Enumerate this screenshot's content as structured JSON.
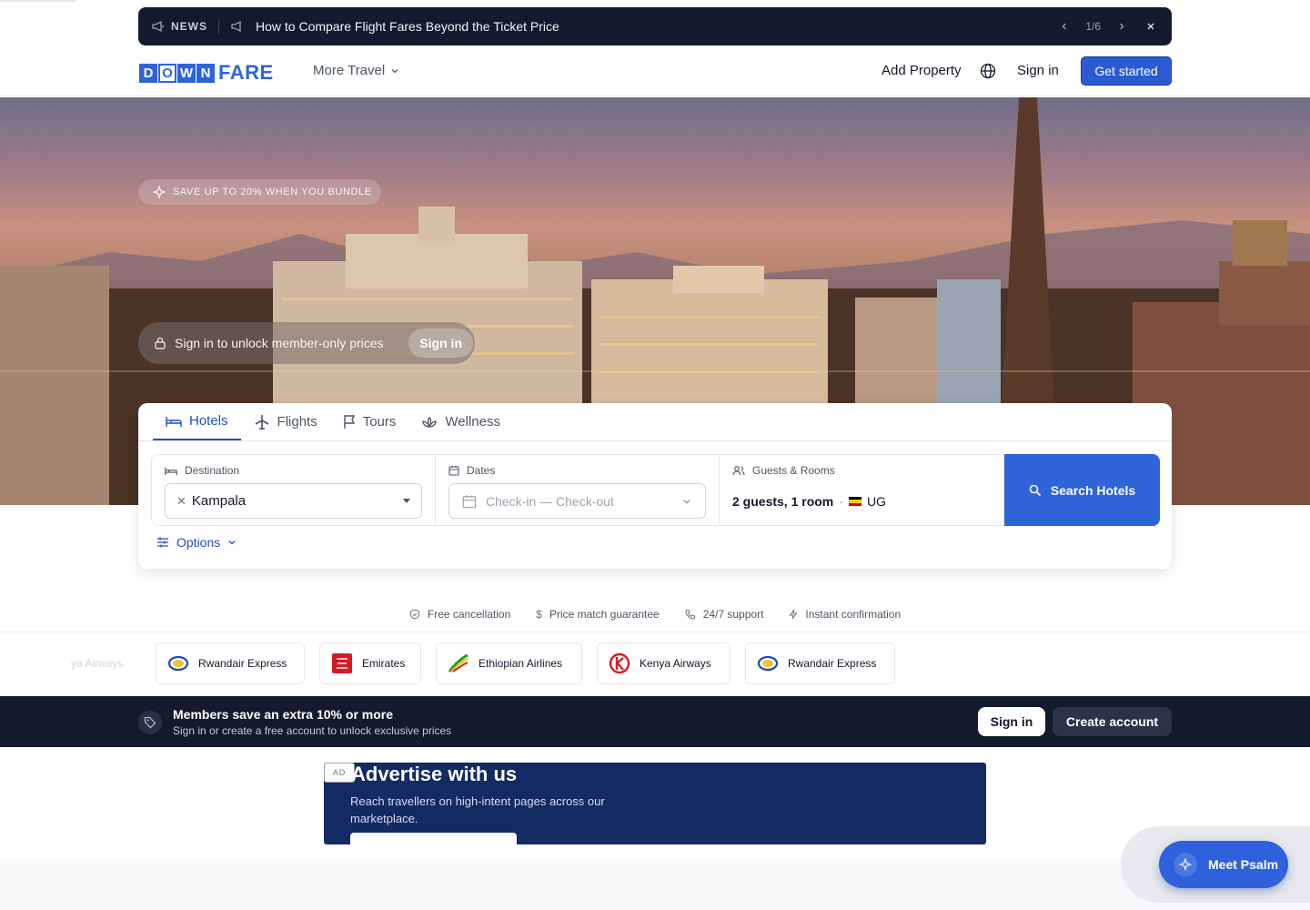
{
  "news": {
    "label": "NEWS",
    "title": "How to Compare Flight Fares Beyond the Ticket Price",
    "pager": "1/6"
  },
  "header": {
    "logo_letters": [
      "D",
      "O",
      "W",
      "N"
    ],
    "logo_suffix": "FARE",
    "more_travel": "More Travel",
    "add_property": "Add Property",
    "sign_in": "Sign in",
    "get_started": "Get started"
  },
  "hero": {
    "promo_badge": "SAVE UP TO 20% WHEN YOU BUNDLE",
    "member_text": "Sign in to unlock member-only prices",
    "member_button": "Sign in"
  },
  "search": {
    "tabs": [
      {
        "label": "Hotels",
        "icon": "bed-icon",
        "active": true
      },
      {
        "label": "Flights",
        "icon": "plane-icon",
        "active": false
      },
      {
        "label": "Tours",
        "icon": "flag-icon",
        "active": false
      },
      {
        "label": "Wellness",
        "icon": "lotus-icon",
        "active": false
      }
    ],
    "destination": {
      "label": "Destination",
      "value": "Kampala"
    },
    "dates": {
      "label": "Dates",
      "placeholder": "Check-in — Check-out"
    },
    "guests": {
      "label": "Guests & Rooms",
      "value": "2 guests, 1 room",
      "separator": "·",
      "country": "UG"
    },
    "button": "Search Hotels",
    "options": "Options"
  },
  "features": [
    {
      "label": "Free cancellation",
      "icon": "shield-icon"
    },
    {
      "label": "Price match guarantee",
      "icon": "dollar-icon"
    },
    {
      "label": "24/7 support",
      "icon": "phone-icon"
    },
    {
      "label": "Instant confirmation",
      "icon": "bolt-icon"
    }
  ],
  "airlines": {
    "ghost": "ya Airways",
    "items": [
      "Rwandair Express",
      "Emirates",
      "Ethiopian Airlines",
      "Kenya Airways",
      "Rwandair Express"
    ]
  },
  "members": {
    "title": "Members save an extra 10% or more",
    "subtitle": "Sign in or create a free account to unlock exclusive prices",
    "sign_in": "Sign in",
    "create": "Create account"
  },
  "ad": {
    "badge": "AD",
    "title": "Advertise with us",
    "text": "Reach travellers on high-intent pages across our marketplace."
  },
  "assistant": {
    "label": "Meet Psalm"
  },
  "colors": {
    "brand": "#2f63d8",
    "navy": "#131a2e",
    "ad_bg": "#132a63"
  }
}
